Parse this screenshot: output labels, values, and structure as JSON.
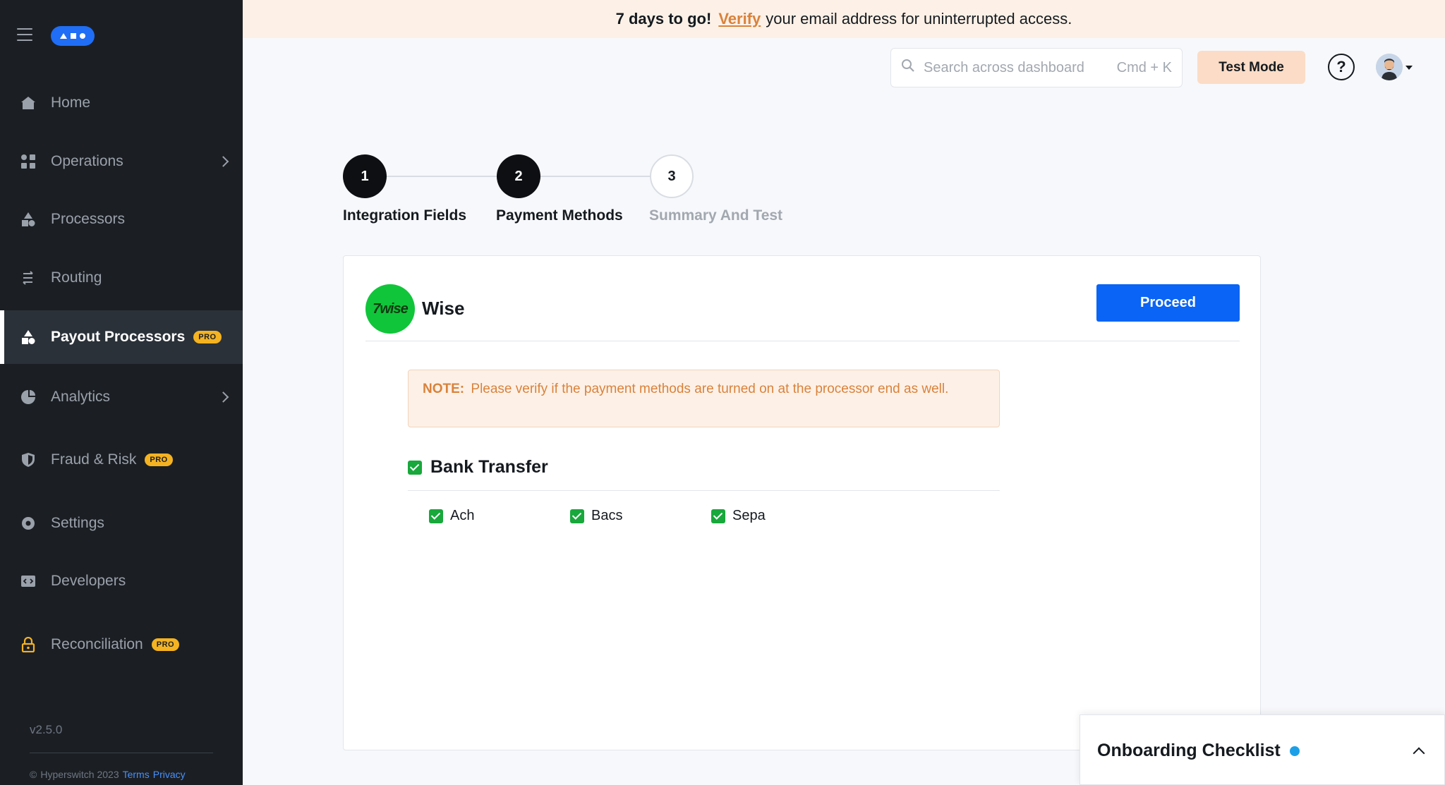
{
  "banner": {
    "countdown": "7 days to go!",
    "verify_link": "Verify",
    "message": "your email address for uninterrupted access."
  },
  "sidebar": {
    "items": [
      {
        "label": "Home",
        "icon": "home-icon"
      },
      {
        "label": "Operations",
        "icon": "operations-icon",
        "has_submenu": true
      },
      {
        "label": "Processors",
        "icon": "processors-icon"
      },
      {
        "label": "Routing",
        "icon": "routing-icon"
      },
      {
        "label": "Payout Processors",
        "icon": "payout-processors-icon",
        "active": true,
        "badge": "PRO"
      },
      {
        "label": "Analytics",
        "icon": "analytics-icon",
        "has_submenu": true
      },
      {
        "label": "Fraud & Risk",
        "icon": "shield-icon",
        "badge": "PRO"
      },
      {
        "label": "Settings",
        "icon": "gear-icon"
      },
      {
        "label": "Developers",
        "icon": "code-icon"
      },
      {
        "label": "Reconciliation",
        "icon": "lock-icon",
        "badge": "PRO"
      }
    ],
    "version": "v2.5.0",
    "footer": {
      "copyright": "Hyperswitch 2023",
      "terms": "Terms",
      "privacy": "Privacy"
    }
  },
  "topbar": {
    "search_placeholder": "Search across dashboard",
    "search_shortcut": "Cmd + K",
    "test_mode": "Test Mode",
    "help": "?"
  },
  "stepper": {
    "steps": [
      {
        "number": "1",
        "label": "Integration Fields",
        "state": "done"
      },
      {
        "number": "2",
        "label": "Payment Methods",
        "state": "current"
      },
      {
        "number": "3",
        "label": "Summary And Test",
        "state": "todo"
      }
    ]
  },
  "connector": {
    "logo_text": "7wise",
    "name": "Wise",
    "proceed": "Proceed",
    "note_label": "NOTE:",
    "note_text": "Please verify if the payment methods are turned on at the processor end as well.",
    "payment_method": {
      "title": "Bank Transfer",
      "checked": true,
      "sub_methods": [
        {
          "label": "Ach",
          "checked": true
        },
        {
          "label": "Bacs",
          "checked": true
        },
        {
          "label": "Sepa",
          "checked": true
        }
      ]
    }
  },
  "onboarding": {
    "title": "Onboarding Checklist"
  },
  "colors": {
    "sidebar_bg": "#1b1f24",
    "accent_blue": "#0a64f5",
    "pro_badge": "#f5b321",
    "note_text": "#d9823b",
    "check_green": "#18a83b",
    "wise_green": "#10c53a"
  }
}
